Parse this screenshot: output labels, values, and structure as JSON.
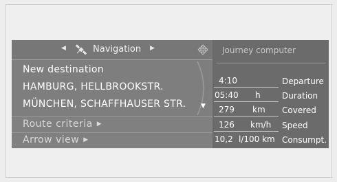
{
  "navigation": {
    "title": "Navigation",
    "destinations": [
      "New destination",
      "HAMBURG, HELLBROOKSTR.",
      "MÜNCHEN, SCHAFFHAUSER STR."
    ],
    "menu_items": [
      {
        "label": "Route criteria"
      },
      {
        "label": "Arrow view"
      }
    ],
    "icons": {
      "header": "satellite-icon",
      "settings": "settings-arrows-icon",
      "scroll": "chevron-down-icon"
    }
  },
  "journey_computer": {
    "title": "Journey computer",
    "rows": [
      {
        "value": "4:10",
        "unit": "",
        "label": "Departure"
      },
      {
        "value": "05:40",
        "unit": "h",
        "label": "Duration"
      },
      {
        "value": "279",
        "unit": "km",
        "label": "Covered"
      },
      {
        "value": "126",
        "unit": "km/h",
        "label": "Speed"
      },
      {
        "value": "10,2",
        "unit": "l/100 km",
        "label": "Consumpt."
      }
    ]
  }
}
